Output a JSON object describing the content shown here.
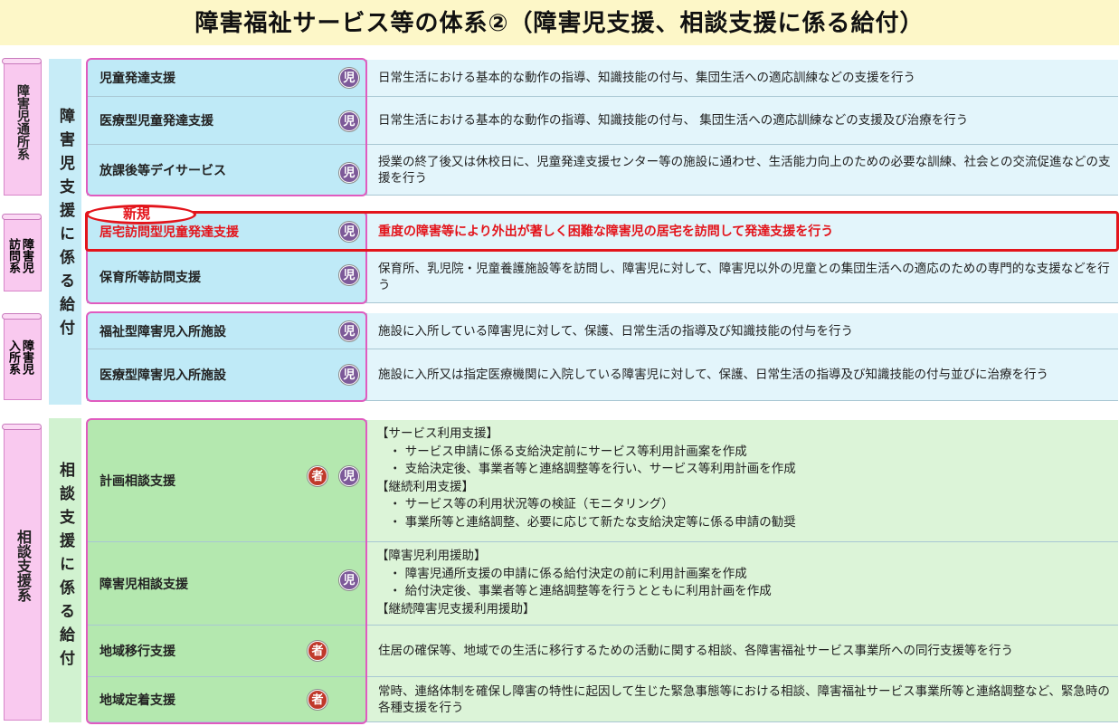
{
  "title": "障害福祉サービス等の体系②（障害児支援、相談支援に係る給付）",
  "badges": {
    "child": "児",
    "adult": "者"
  },
  "categories": {
    "tsusho": "障害児通所系",
    "homon": "障害児訪問系",
    "nyusho": "障害児入所系",
    "soudan": "相談支援系"
  },
  "groups": {
    "child_support": "障害児支援に係る給付",
    "consult_support": "相談支援に係る給付"
  },
  "new_label": "新規",
  "services": [
    {
      "name": "児童発達支援",
      "desc": "日常生活における基本的な動作の指導、知識技能の付与、集団生活への適応訓練などの支援を行う"
    },
    {
      "name": "医療型児童発達支援",
      "desc": "日常生活における基本的な動作の指導、知識技能の付与、 集団生活への適応訓練などの支援及び治療を行う"
    },
    {
      "name": "放課後等デイサービス",
      "desc": "授業の終了後又は休校日に、児童発達支援センター等の施設に通わせ、生活能力向上のための必要な訓練、社会との交流促進などの支援を行う"
    },
    {
      "name": "居宅訪問型児童発達支援",
      "desc": "重度の障害等により外出が著しく困難な障害児の居宅を訪問して発達支援を行う"
    },
    {
      "name": "保育所等訪問支援",
      "desc": "保育所、乳児院・児童養護施設等を訪問し、障害児に対して、障害児以外の児童との集団生活への適応のための専門的な支援などを行う"
    },
    {
      "name": "福祉型障害児入所施設",
      "desc": "施設に入所している障害児に対して、保護、日常生活の指導及び知識技能の付与を行う"
    },
    {
      "name": "医療型障害児入所施設",
      "desc": "施設に入所又は指定医療機関に入院している障害児に対して、保護、日常生活の指導及び知識技能の付与並びに治療を行う"
    }
  ],
  "consult": [
    {
      "name": "計画相談支援",
      "lines": [
        "【サービス利用支援】",
        "・ サービス申請に係る支給決定前にサービス等利用計画案を作成",
        "・ 支給決定後、事業者等と連絡調整等を行い、サービス等利用計画を作成",
        "【継続利用支援】",
        "・ サービス等の利用状況等の検証（モニタリング）",
        "・ 事業所等と連絡調整、必要に応じて新たな支給決定等に係る申請の勧奨"
      ]
    },
    {
      "name": "障害児相談支援",
      "lines": [
        "【障害児利用援助】",
        "・ 障害児通所支援の申請に係る給付決定の前に利用計画案を作成",
        "・ 給付決定後、事業者等と連絡調整等を行うとともに利用計画を作成",
        "【継続障害児支援利用援助】"
      ]
    },
    {
      "name": "地域移行支援",
      "lines": [
        "住居の確保等、地域での生活に移行するための活動に関する相談、各障害福祉サービス事業所への同行支援等を行う"
      ]
    },
    {
      "name": "地域定着支援",
      "lines": [
        "常時、連絡体制を確保し障害の特性に起因して生じた緊急事態等における相談、障害福祉サービス事業所等と連絡調整など、緊急時の各種支援を行う"
      ]
    }
  ]
}
